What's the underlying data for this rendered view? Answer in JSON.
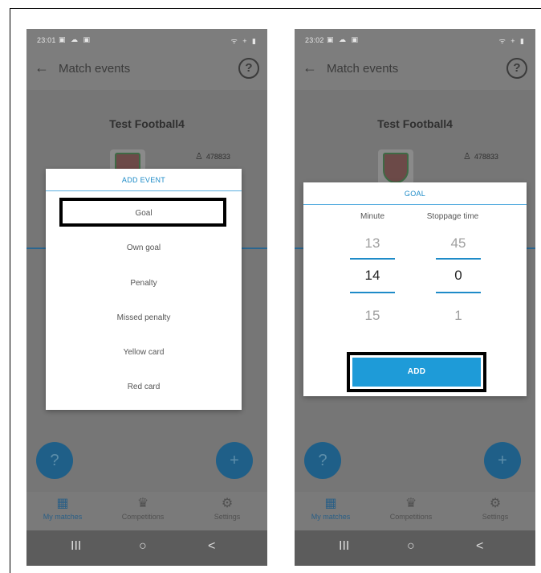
{
  "screen1": {
    "status": {
      "time": "23:01",
      "left_icons": "▣ ☁ ▣",
      "right_icons": "ᯤ + ▮"
    },
    "appbar": {
      "back_icon": "←",
      "title": "Match events",
      "help_icon": "?"
    },
    "team_name": "Test Football4",
    "user_id": "478833",
    "dialog": {
      "title": "ADD EVENT",
      "items": [
        "Goal",
        "Own goal",
        "Penalty",
        "Missed penalty",
        "Yellow card",
        "Red card"
      ],
      "highlighted_item": "Goal"
    },
    "fab_left_icon": "?",
    "fab_right_icon": "+",
    "nav": [
      "My matches",
      "Competitions",
      "Settings"
    ],
    "system_nav": [
      "III",
      "○",
      "<"
    ]
  },
  "screen2": {
    "status": {
      "time": "23:02",
      "left_icons": "▣ ☁ ▣",
      "right_icons": "ᯤ + ▮"
    },
    "appbar": {
      "back_icon": "←",
      "title": "Match events",
      "help_icon": "?"
    },
    "team_name": "Test Football4",
    "user_id": "478833",
    "dialog": {
      "title": "GOAL",
      "minute_label": "Minute",
      "stoppage_label": "Stoppage time",
      "minute_values": [
        "13",
        "14",
        "15"
      ],
      "stoppage_values": [
        "45",
        "0",
        "1"
      ],
      "add_label": "ADD"
    },
    "fab_left_icon": "?",
    "fab_right_icon": "+",
    "nav": [
      "My matches",
      "Competitions",
      "Settings"
    ],
    "system_nav": [
      "III",
      "○",
      "<"
    ]
  },
  "colors": {
    "accent": "#1e9bd8",
    "overlay_gray": "#7d7d7d",
    "dialog_bg": "#ffffff",
    "highlight_border": "#000000"
  }
}
